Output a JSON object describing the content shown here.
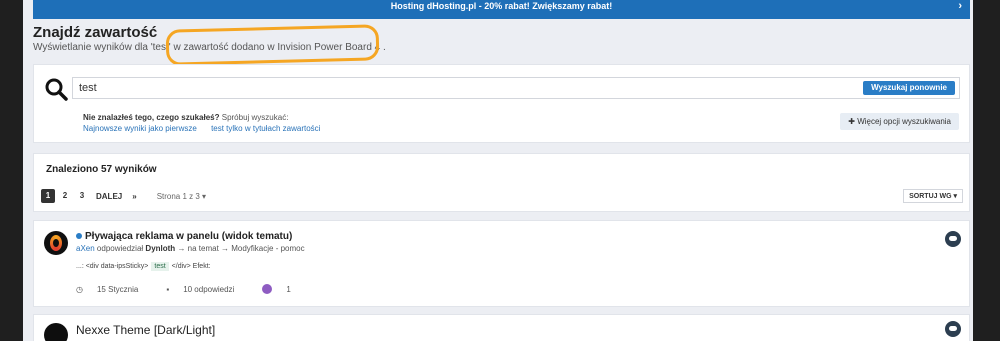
{
  "banner": {
    "text": "Hosting dHosting.pl - 20% rabat! Zwiększamy rabat!",
    "arrow": "›"
  },
  "header": {
    "title": "Znajdź zawartość",
    "subtitle": "Wyświetlanie wyników dla 'test' w zawartość dodano w Invision Power Board 4 ."
  },
  "search": {
    "value": "test",
    "button": "Wyszukaj ponownie",
    "hint_bold": "Nie znalazłeś tego, czego szukałeś?",
    "hint_rest": "Spróbuj wyszukać:",
    "link1": "Najnowsze wyniki jako pierwsze",
    "link2": "test tylko w tytułach zawartości",
    "more": "Więcej opcji wyszukiwania"
  },
  "results": {
    "title": "Znaleziono 57 wyników",
    "pages": [
      "1",
      "2",
      "3"
    ],
    "next": "DALEJ",
    "last": "»",
    "page_of": "Strona 1 z 3",
    "sort": "SORTUJ WG"
  },
  "item1": {
    "title": "Pływająca reklama w panelu (widok tematu)",
    "user": "aXen",
    "replied": "odpowiedział",
    "author": "Dynloth",
    "path": "→ na temat → Modyfikacje - pomoc",
    "snippet_pre": "...: <div data-ipsSticky>",
    "snippet_hl": "test",
    "snippet_post": "</div> Efekt:",
    "date": "15 Stycznia",
    "replies": "10 odpowiedzi",
    "reactions": "1"
  },
  "item2": {
    "title": "Nexxe Theme [Dark/Light]"
  },
  "colors": {
    "accent": "#2a7dc6",
    "annotation": "#f5a623"
  }
}
